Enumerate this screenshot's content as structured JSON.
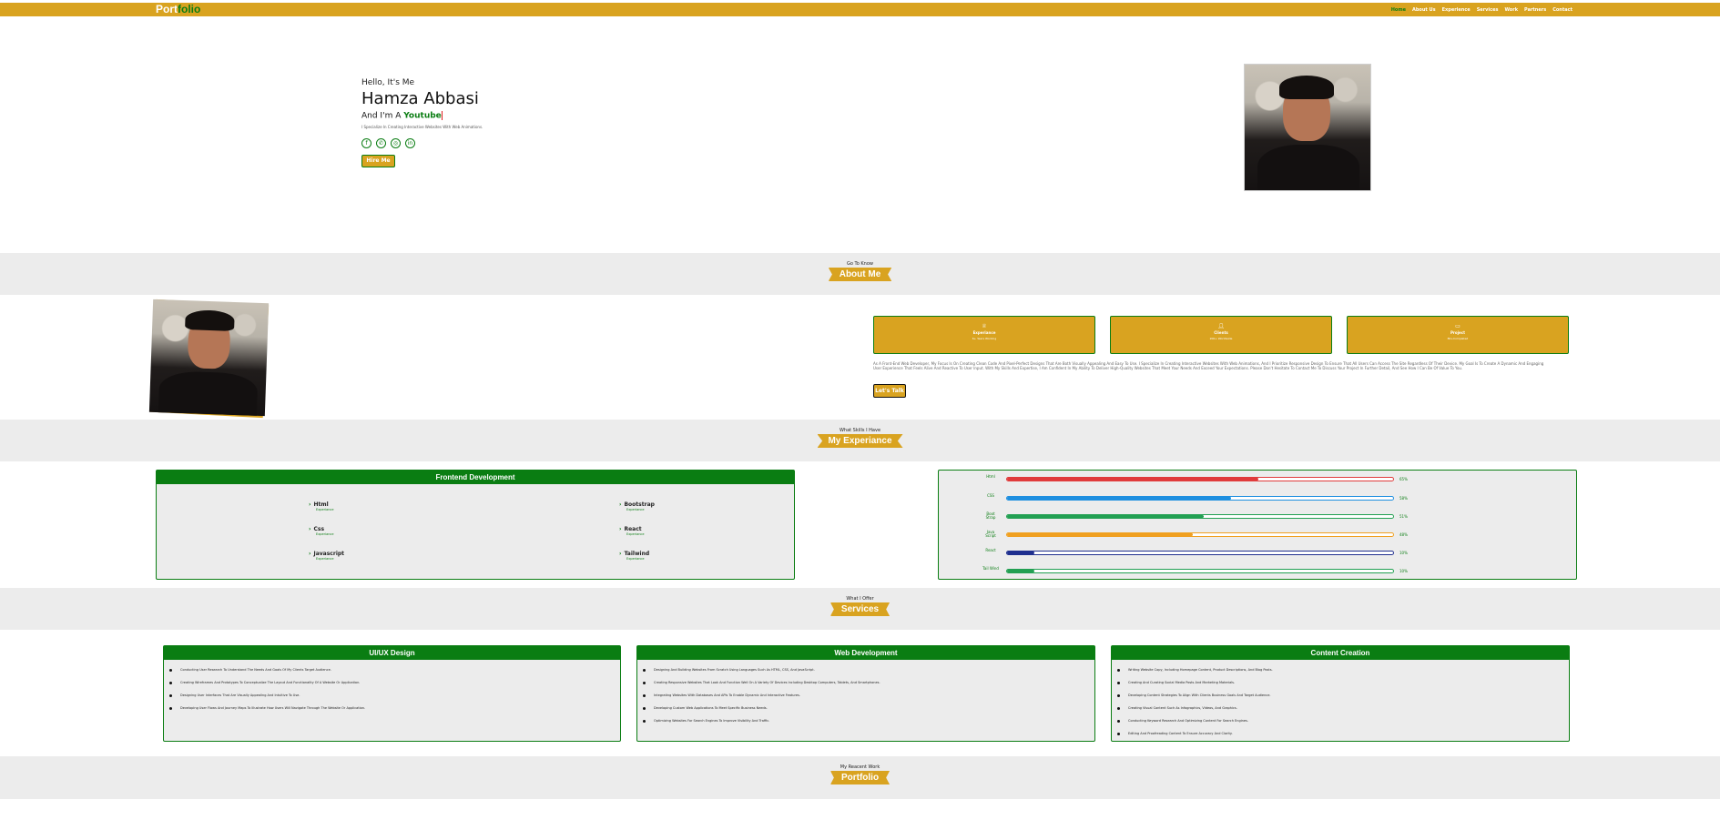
{
  "nav": {
    "logo_part1": "Port",
    "logo_part2": "folio",
    "links": [
      "Home",
      "About Us",
      "Experience",
      "Services",
      "Work",
      "Partners",
      "Contact"
    ]
  },
  "hero": {
    "greeting": "Hello, It's Me",
    "name": "Hamza Abbasi",
    "role_prefix": "And I'm A",
    "role_word": "Youtube",
    "tagline": "I Specialize In Creating Interactive Websites With Web Animations.",
    "social_icons": [
      "facebook-icon",
      "whatsapp-icon",
      "instagram-icon",
      "linkedin-icon"
    ],
    "hire_label": "Hire Me"
  },
  "about": {
    "kicker": "Go To Know",
    "title": "About Me",
    "cards": [
      {
        "icon": "award-icon",
        "title": "Experiance",
        "sub": "6+ Years Working"
      },
      {
        "icon": "user-icon",
        "title": "Clients",
        "sub": "200+ Worldwide"
      },
      {
        "icon": "laptop-icon",
        "title": "Project",
        "sub": "80+Completed"
      }
    ],
    "paragraph": "As A Front-End Web Developer, My Focus Is On Creating Clean Code And Pixel-Perfect Designs That Are Both Visually Appealing And Easy To Use. I Specialize In Creating Interactive Websites With Web Animations, And I Prioritize Responsive Design To Ensure That All Users Can Access The Site Regardless Of Their Device. My Goal Is To Create A Dynamic And Engaging User Experience That Feels Alive And Reactive To User Input. With My Skills And Expertise, I Am Confident In My Ability To Deliver High-Quality Websites That Meet Your Needs And Exceed Your Expectations. Please Don't Hesitate To Contact Me To Discuss Your Project In Further Detail, And See How I Can Be Of Value To You.",
    "cta": "Let's Talk"
  },
  "experience": {
    "kicker": "What Skills I Have",
    "title": "My Experiance",
    "panel_title": "Frontend Development",
    "skills": [
      {
        "label": "Html",
        "sub": "Experiance"
      },
      {
        "label": "Bootstrap",
        "sub": "Experiance"
      },
      {
        "label": "Css",
        "sub": "Experiance"
      },
      {
        "label": "React",
        "sub": "Experiance"
      },
      {
        "label": "Javascript",
        "sub": "Experiance"
      },
      {
        "label": "Tailwind",
        "sub": "Experiance"
      }
    ],
    "bars": [
      {
        "label": "Html",
        "pct": 65,
        "pct_text": "65%",
        "color": "#e03b3b"
      },
      {
        "label": "CSS",
        "pct": 58,
        "pct_text": "58%",
        "color": "#1e8fe0"
      },
      {
        "label": "Boot Strap",
        "pct": 51,
        "pct_text": "51%",
        "color": "#22a052"
      },
      {
        "label": "Java Script",
        "pct": 48,
        "pct_text": "48%",
        "color": "#f0a020"
      },
      {
        "label": "React",
        "pct": 7,
        "pct_text": "10%",
        "color": "#1f2f8f"
      },
      {
        "label": "Tail Wind",
        "pct": 7,
        "pct_text": "10%",
        "color": "#22a052"
      }
    ]
  },
  "services": {
    "kicker": "What I Offer",
    "title": "Services",
    "cards": [
      {
        "title": "UI/UX Design",
        "items": [
          "Conducting User Research To Understand The Needs And Goals Of My Clients Target Audience.",
          "Creating Wireframes And Prototypes To Conceptualize The Layout And Functionality Of A Website Or Application.",
          "Designing User Interfaces That Are Visually Appealing And Intuitive To Use.",
          "Developing User Flows And Journey Maps To Illustrate How Users Will Navigate Through The Website Or Application."
        ]
      },
      {
        "title": "Web Development",
        "items": [
          "Designing And Building Websites From Scratch Using Languages Such As HTML, CSS, And JavaScript.",
          "Creating Responsive Websites That Look And Function Well On A Variety Of Devices Including Desktop Computers, Tablets, And Smartphones.",
          "Integrating Websites With Databases And APIs To Enable Dynamic And Interactive Features.",
          "Developing Custom Web Applications To Meet Specific Business Needs.",
          "Optimizing Websites For Search Engines To Improve Visibility And Traffic."
        ]
      },
      {
        "title": "Content Creation",
        "items": [
          "Writing Website Copy, Including Homepage Content, Product Descriptions, And Blog Posts.",
          "Creating And Curating Social Media Posts And Marketing Materials.",
          "Developing Content Strategies To Align With Clients Business Goals And Target Audience.",
          "Creating Visual Content Such As Infographics, Videos, And Graphics.",
          "Conducting Keyword Research And Optimizing Content For Search Engines.",
          "Editing And Proofreading Content To Ensure Accuracy And Clarity."
        ]
      }
    ]
  },
  "portfolio": {
    "kicker": "My Reacent Work",
    "title": "Portfolio"
  }
}
